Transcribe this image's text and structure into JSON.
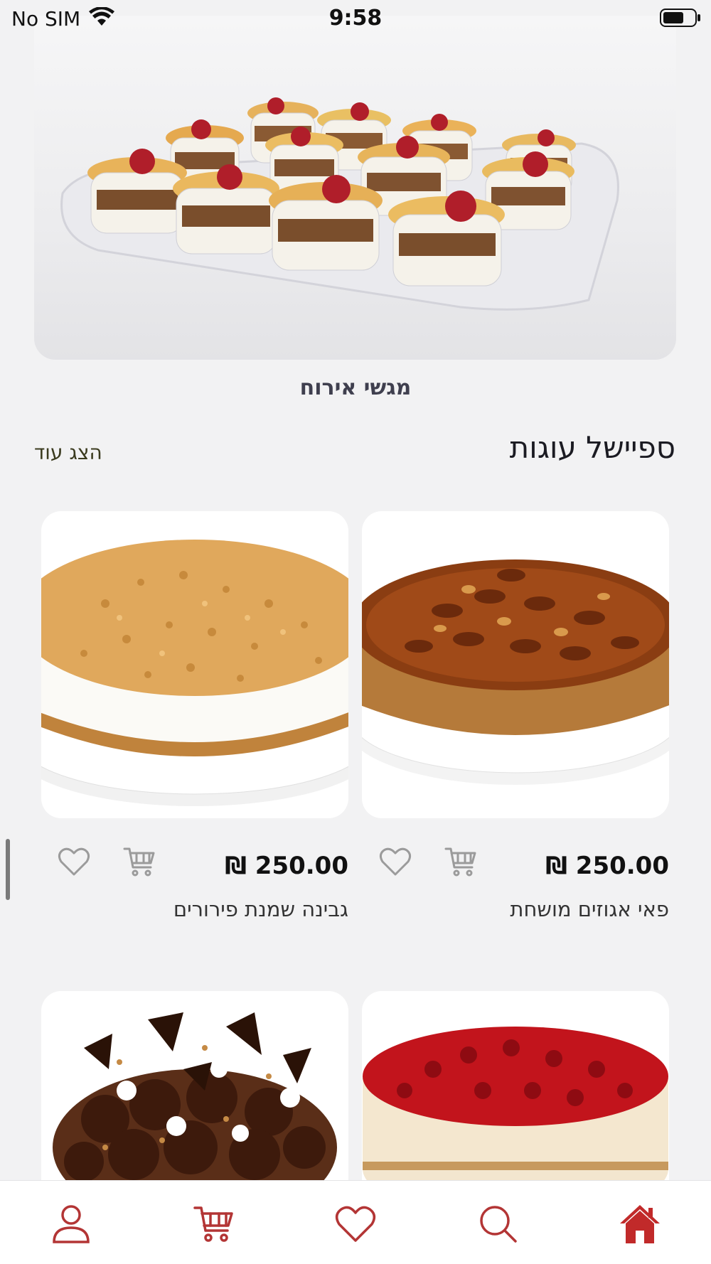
{
  "status_bar": {
    "carrier": "No SIM",
    "time": "9:58"
  },
  "hero": {
    "category_title": "מגשי אירוח"
  },
  "section": {
    "title": "ספיישל עוגות",
    "show_more": "הצג עוד"
  },
  "products": [
    {
      "name": "פאי אגוזים מושחת",
      "price": "₪ 250.00"
    },
    {
      "name": "גבינה שמנת פירורים",
      "price": "₪ 250.00"
    },
    {
      "name": "",
      "price": ""
    },
    {
      "name": "",
      "price": ""
    }
  ],
  "tabbar": {
    "items": [
      "home-icon",
      "search-icon",
      "heart-icon",
      "cart-icon",
      "user-icon"
    ],
    "accent_color": "#c12a2a",
    "icon_color": "#b33535"
  }
}
